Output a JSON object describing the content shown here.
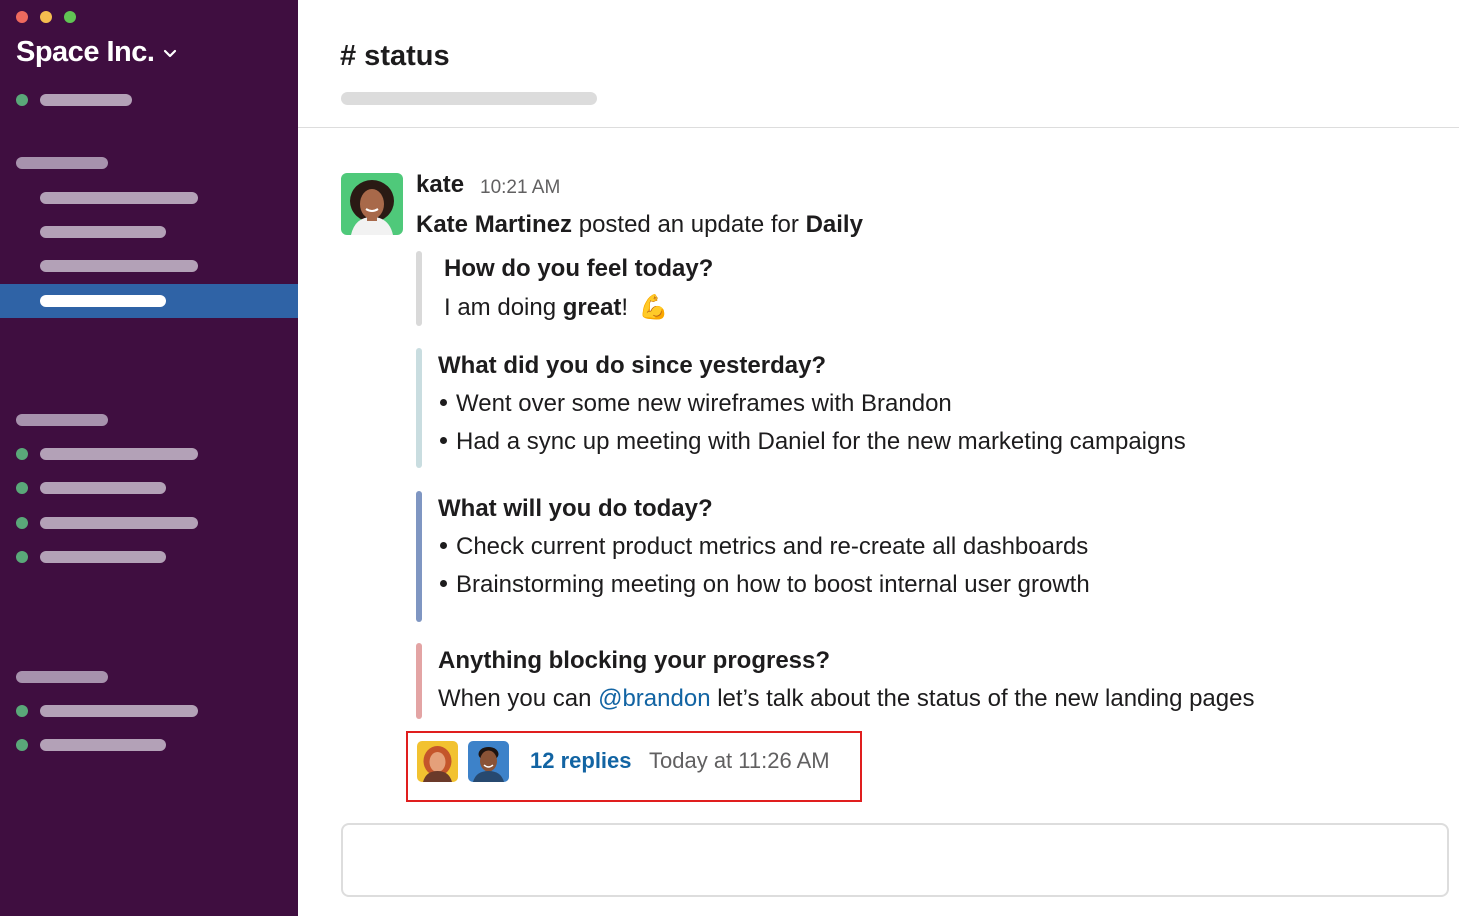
{
  "window": {
    "controls": [
      "close",
      "minimize",
      "zoom"
    ]
  },
  "workspace": {
    "name": "Space Inc.",
    "chevron_icon": "chevron-down-icon"
  },
  "channel": {
    "title": "# status"
  },
  "message": {
    "author": "kate",
    "time": "10:21 AM",
    "intro_name": "Kate Martinez",
    "intro_text": " posted an update for ",
    "intro_target": "Daily",
    "sections": [
      {
        "question": "How do you feel today?",
        "answer_prefix": "I am doing ",
        "answer_bold": "great",
        "answer_suffix": "!",
        "emoji": "💪",
        "bar_color": "#d9d9d9"
      },
      {
        "question": "What did you do since yesterday?",
        "bullets": [
          "Went over some new wireframes with Brandon",
          "Had a sync up meeting with Daniel for the new marketing campaigns"
        ],
        "bar_color": "#c9dde0"
      },
      {
        "question": "What will you do today?",
        "bullets": [
          "Check current product metrics and re-create all dashboards",
          "Brainstorming meeting on how to boost internal user growth"
        ],
        "bar_color": "#7f96c2"
      },
      {
        "question": "Anything blocking your progress?",
        "answer_prefix": "When you can ",
        "mention": "@brandon",
        "answer_suffix": " let’s talk about the status of the new landing pages",
        "bar_color": "#e3a4a4"
      }
    ],
    "thread": {
      "replies": "12 replies",
      "last_reply": "Today at 11:26 AM"
    }
  },
  "colors": {
    "sidebar": "#3f0e40",
    "sidebar_selected": "#2f63a6",
    "presence": "#5aa879",
    "link": "#1264a3",
    "highlight": "#e01e1e"
  }
}
